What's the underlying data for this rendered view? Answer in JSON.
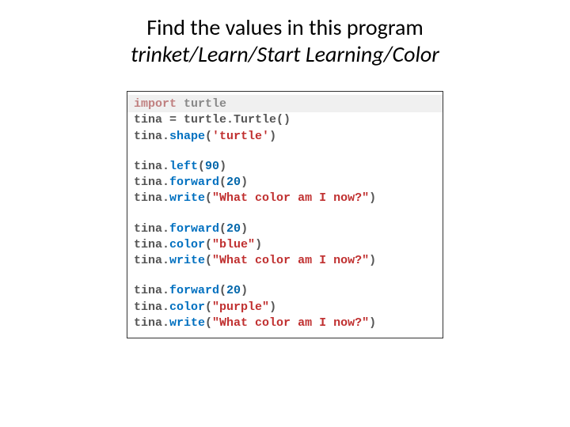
{
  "header": {
    "title": "Find the values in this program",
    "subtitle": "trinket/Learn/Start Learning/Color"
  },
  "code": {
    "lines": [
      {
        "type": "line",
        "highlighted": true,
        "tokens": [
          {
            "cls": "t-keyword",
            "text": "import"
          },
          {
            "cls": "t-default",
            "text": " "
          },
          {
            "cls": "t-turtle-mod",
            "text": "turtle"
          }
        ]
      },
      {
        "type": "line",
        "tokens": [
          {
            "cls": "t-default",
            "text": "tina = turtle.Turtle()"
          }
        ]
      },
      {
        "type": "line",
        "tokens": [
          {
            "cls": "t-default",
            "text": "tina."
          },
          {
            "cls": "t-method",
            "text": "shape"
          },
          {
            "cls": "t-paren",
            "text": "("
          },
          {
            "cls": "t-string-single",
            "text": "'turtle'"
          },
          {
            "cls": "t-paren",
            "text": ")"
          }
        ]
      },
      {
        "type": "blank"
      },
      {
        "type": "line",
        "tokens": [
          {
            "cls": "t-default",
            "text": "tina."
          },
          {
            "cls": "t-method",
            "text": "left"
          },
          {
            "cls": "t-paren",
            "text": "("
          },
          {
            "cls": "t-number",
            "text": "90"
          },
          {
            "cls": "t-paren",
            "text": ")"
          }
        ]
      },
      {
        "type": "line",
        "tokens": [
          {
            "cls": "t-default",
            "text": "tina."
          },
          {
            "cls": "t-method",
            "text": "forward"
          },
          {
            "cls": "t-paren",
            "text": "("
          },
          {
            "cls": "t-number",
            "text": "20"
          },
          {
            "cls": "t-paren",
            "text": ")"
          }
        ]
      },
      {
        "type": "line",
        "tokens": [
          {
            "cls": "t-default",
            "text": "tina."
          },
          {
            "cls": "t-method",
            "text": "write"
          },
          {
            "cls": "t-paren",
            "text": "("
          },
          {
            "cls": "t-string-double",
            "text": "\"What color am I now?\""
          },
          {
            "cls": "t-paren",
            "text": ")"
          }
        ]
      },
      {
        "type": "blank"
      },
      {
        "type": "line",
        "tokens": [
          {
            "cls": "t-default",
            "text": "tina."
          },
          {
            "cls": "t-method",
            "text": "forward"
          },
          {
            "cls": "t-paren",
            "text": "("
          },
          {
            "cls": "t-number",
            "text": "20"
          },
          {
            "cls": "t-paren",
            "text": ")"
          }
        ]
      },
      {
        "type": "line",
        "tokens": [
          {
            "cls": "t-default",
            "text": "tina."
          },
          {
            "cls": "t-method",
            "text": "color"
          },
          {
            "cls": "t-paren",
            "text": "("
          },
          {
            "cls": "t-string-double",
            "text": "\"blue\""
          },
          {
            "cls": "t-paren",
            "text": ")"
          }
        ]
      },
      {
        "type": "line",
        "tokens": [
          {
            "cls": "t-default",
            "text": "tina."
          },
          {
            "cls": "t-method",
            "text": "write"
          },
          {
            "cls": "t-paren",
            "text": "("
          },
          {
            "cls": "t-string-double",
            "text": "\"What color am I now?\""
          },
          {
            "cls": "t-paren",
            "text": ")"
          }
        ]
      },
      {
        "type": "blank"
      },
      {
        "type": "line",
        "tokens": [
          {
            "cls": "t-default",
            "text": "tina."
          },
          {
            "cls": "t-method",
            "text": "forward"
          },
          {
            "cls": "t-paren",
            "text": "("
          },
          {
            "cls": "t-number",
            "text": "20"
          },
          {
            "cls": "t-paren",
            "text": ")"
          }
        ]
      },
      {
        "type": "line",
        "tokens": [
          {
            "cls": "t-default",
            "text": "tina."
          },
          {
            "cls": "t-method",
            "text": "color"
          },
          {
            "cls": "t-paren",
            "text": "("
          },
          {
            "cls": "t-string-double",
            "text": "\"purple\""
          },
          {
            "cls": "t-paren",
            "text": ")"
          }
        ]
      },
      {
        "type": "line",
        "tokens": [
          {
            "cls": "t-default",
            "text": "tina."
          },
          {
            "cls": "t-method",
            "text": "write"
          },
          {
            "cls": "t-paren",
            "text": "("
          },
          {
            "cls": "t-string-double",
            "text": "\"What color am I now?\""
          },
          {
            "cls": "t-paren",
            "text": ")"
          }
        ]
      }
    ]
  }
}
